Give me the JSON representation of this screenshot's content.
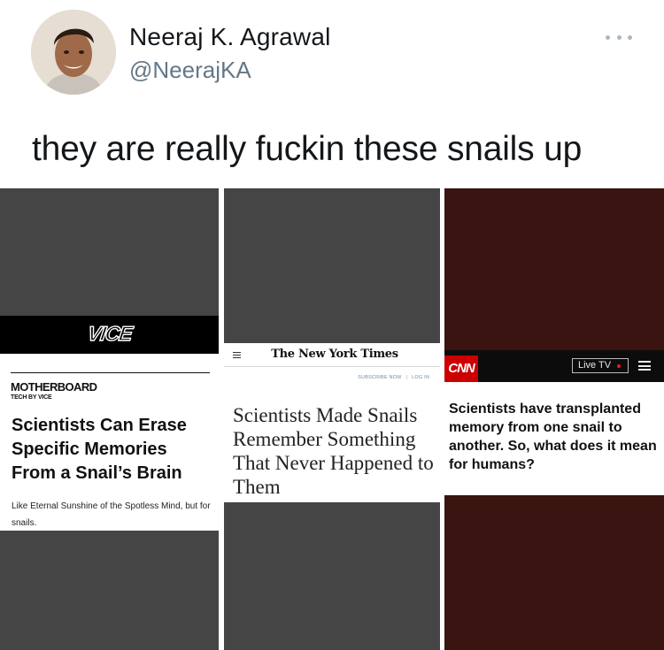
{
  "tweet": {
    "author_name": "Neeraj K. Agrawal",
    "author_handle": "@NeerajKA",
    "text": "they are really fuckin these snails up",
    "more_icon": "ellipsis-icon"
  },
  "images": {
    "vice": {
      "logo": "VICE",
      "section": "MOTHERBOARD",
      "kicker": "TECH BY VICE",
      "headline": "Scientists Can Erase Specific Memories From a Snail’s Brain",
      "dek": "Like Eternal Sunshine of the Spotless Mind, but for snails."
    },
    "nyt": {
      "menu_icon": "hamburger-icon",
      "logo": "The New York Times",
      "subscribe_link": "SUBSCRIBE NOW",
      "login_link": "LOG IN",
      "headline": "Scientists Made Snails Remember Something That Never Happened to Them"
    },
    "cnn": {
      "logo": "CNN",
      "live_tv": "Live TV",
      "menu_icon": "hamburger-icon",
      "headline": "Scientists have transplanted memory from one snail to another. So, what does it mean for humans?"
    }
  },
  "colors": {
    "handle_gray": "#657786",
    "vice_panel_bg": "#454545",
    "cnn_panel_bg": "#3a1410",
    "cnn_red": "#cc0000",
    "nyt_link_blue": "#6d8aa8"
  }
}
